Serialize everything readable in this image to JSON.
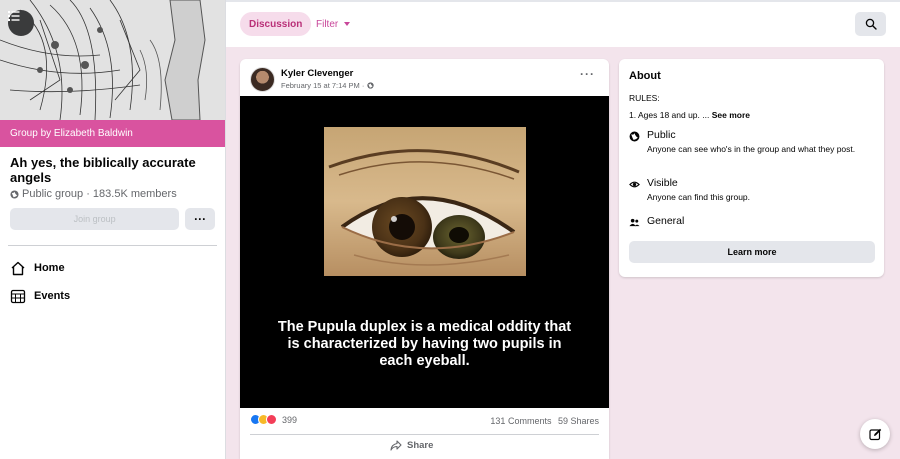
{
  "sidebar": {
    "group_by": "Group by Elizabeth Baldwin",
    "group_title": "Ah yes, the biblically accurate angels",
    "group_meta": "Public group · 183.5K members",
    "join_label": "Join group",
    "more_label": "···",
    "nav": [
      {
        "label": "Home",
        "icon": "home-icon"
      },
      {
        "label": "Events",
        "icon": "calendar-icon"
      }
    ]
  },
  "topbar": {
    "tab_discussion": "Discussion",
    "tab_filter": "Filter"
  },
  "post": {
    "author": "Kyler Clevenger",
    "time": "February 15 at 7:14 PM ·",
    "more_label": "···",
    "caption": "The Pupula duplex is a medical oddity that is characterized by having two pupils in each eyeball.",
    "reaction_count": "399",
    "comments": "131 Comments",
    "shares": "59 Shares",
    "share_label": "Share"
  },
  "about": {
    "title": "About",
    "rules_label": "RULES:",
    "rules_text": "1. Ages 18 and up. ...",
    "see_more": "See more",
    "public_title": "Public",
    "public_sub": "Anyone can see who's in the group and what they post.",
    "visible_title": "Visible",
    "visible_sub": "Anyone can find this group.",
    "general_title": "General",
    "learn_more": "Learn more"
  },
  "colors": {
    "accent": "#d9539f",
    "tab_bg": "#f6dceb",
    "tab_text": "#b93078",
    "page_bg": "#f3e4ec"
  }
}
